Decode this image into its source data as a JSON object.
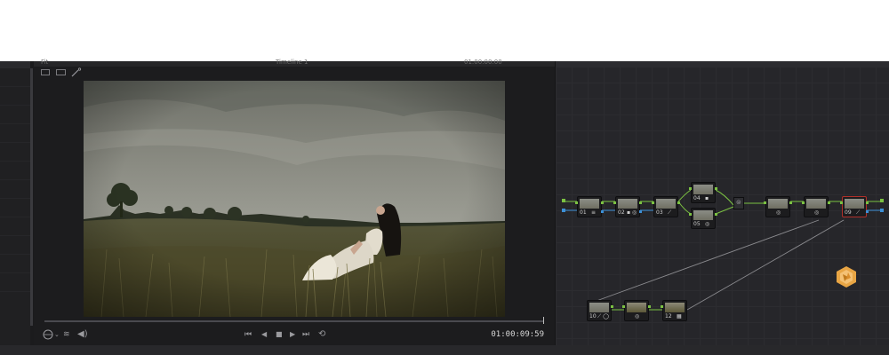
{
  "viewer": {
    "top_left_label": "Fit",
    "timeline_label": "Timeline 1",
    "top_right_label": "01:00:00:00",
    "timecode": "01:00:09:59"
  },
  "nodes": [
    {
      "num": "01",
      "glyph": "≡"
    },
    {
      "num": "02",
      "glyph": "▪ ◎"
    },
    {
      "num": "03",
      "glyph": "⟋"
    },
    {
      "num": "04",
      "glyph": "▪"
    },
    {
      "num": "05",
      "glyph": "◎"
    },
    {
      "num": "",
      "glyph": "◎"
    },
    {
      "num": "",
      "glyph": "◎"
    },
    {
      "num": "09",
      "glyph": "⟋"
    },
    {
      "num": "10",
      "glyph": "⟋ ◯"
    },
    {
      "num": "",
      "glyph": "◎"
    },
    {
      "num": "12",
      "glyph": "▦"
    }
  ],
  "icons": {
    "play": "play-icon",
    "stop": "stop-icon",
    "loop": "loop-icon",
    "speaker": "speaker-icon",
    "logo": "davinci-resolve-logo"
  },
  "colors": {
    "node_link": "#7bc142",
    "key_link": "#3c8fd6",
    "selected_node": "#b0302a"
  }
}
